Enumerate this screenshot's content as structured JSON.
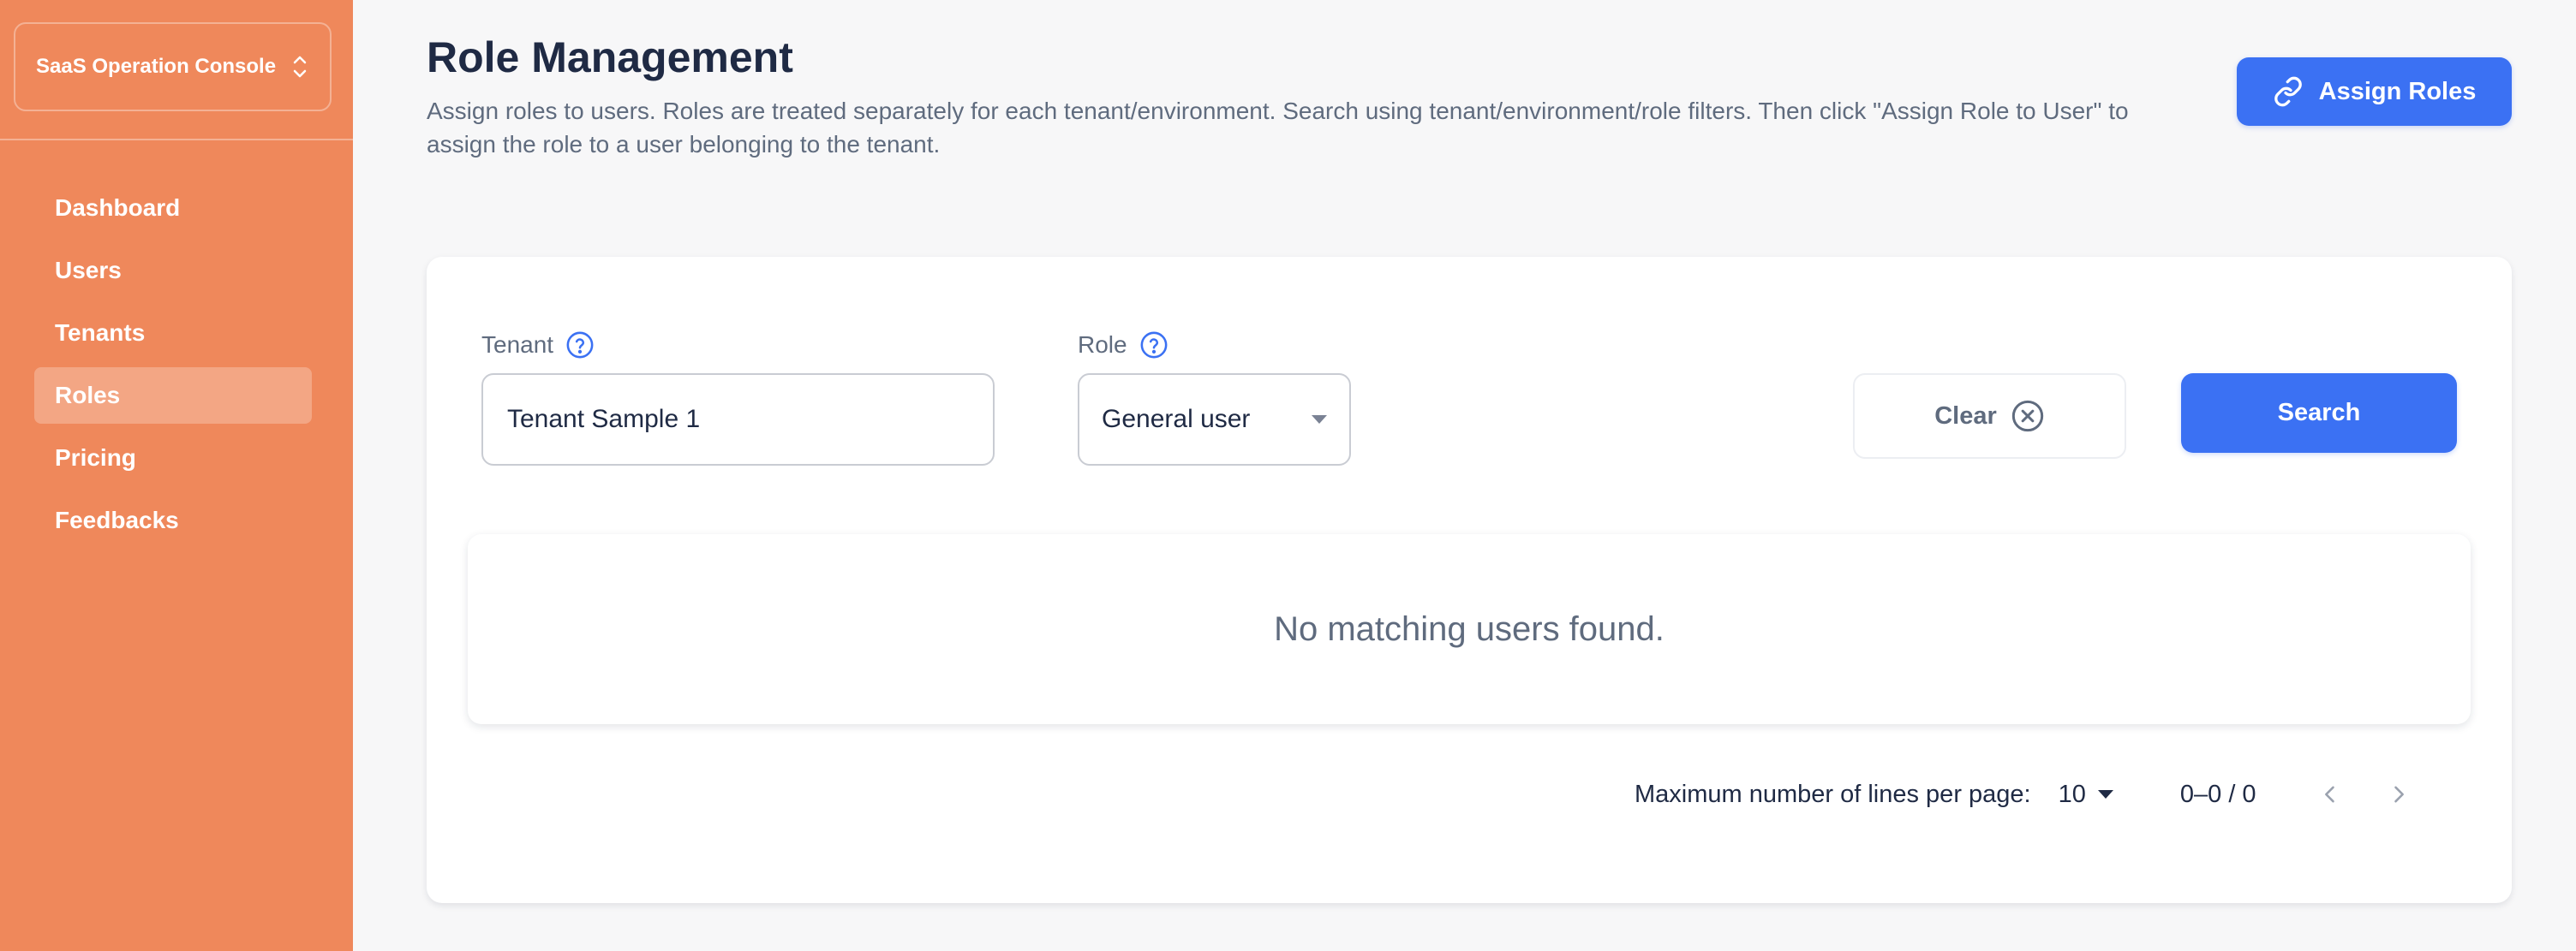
{
  "sidebar": {
    "console_label": "SaaS Operation Console",
    "items": [
      {
        "label": "Dashboard",
        "active": false
      },
      {
        "label": "Users",
        "active": false
      },
      {
        "label": "Tenants",
        "active": false
      },
      {
        "label": "Roles",
        "active": true
      },
      {
        "label": "Pricing",
        "active": false
      },
      {
        "label": "Feedbacks",
        "active": false
      }
    ]
  },
  "header": {
    "title": "Role Management",
    "description": "Assign roles to users. Roles are treated separately for each tenant/environment. Search using tenant/environment/role filters. Then click \"Assign Role to User\" to assign the role to a user belonging to the tenant.",
    "assign_button_label": "Assign Roles"
  },
  "filters": {
    "tenant_label": "Tenant",
    "tenant_value": "Tenant Sample 1",
    "role_label": "Role",
    "role_value": "General user",
    "clear_label": "Clear",
    "search_label": "Search"
  },
  "results": {
    "empty_message": "No matching users found."
  },
  "pagination": {
    "per_page_label": "Maximum number of lines per page:",
    "per_page_value": "10",
    "range_text": "0–0 / 0"
  },
  "colors": {
    "sidebar": "#ef885b",
    "primary": "#3b71f3",
    "background": "#f7f7f8"
  },
  "icons": {
    "console_toggle": "chevron-up-down-icon",
    "assign": "link-icon",
    "help": "question-circle-icon",
    "clear": "x-circle-icon",
    "prev": "chevron-left-icon",
    "next": "chevron-right-icon"
  }
}
